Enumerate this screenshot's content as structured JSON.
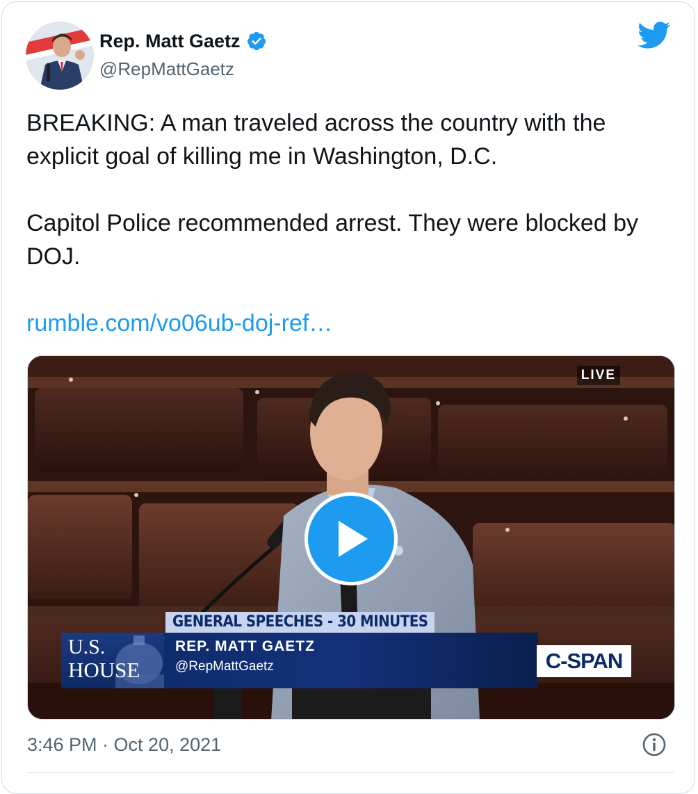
{
  "author": {
    "name": "Rep. Matt Gaetz",
    "handle": "@RepMattGaetz",
    "verified": true,
    "avatar_icon": "avatar-photo"
  },
  "tweet": {
    "paragraphs": [
      "BREAKING: A man traveled across the country with the explicit goal of killing me in Washington, D.C.",
      "Capitol Police recommended arrest. They were blocked by DOJ."
    ],
    "link_text": "rumble.com/vo06ub-doj-ref…"
  },
  "media": {
    "live_badge": "LIVE",
    "lower_third_title": "GENERAL SPEECHES - 30 MINUTES",
    "speaker_name": "REP. MATT GAETZ",
    "speaker_handle": "@RepMattGaetz",
    "house_logo_line1": "U.S.",
    "house_logo_line2": "HOUSE",
    "network_logo": "C-SPAN",
    "play_icon": "play-icon"
  },
  "footer": {
    "timestamp": "3:46 PM · Oct 20, 2021",
    "info_icon": "info-icon"
  },
  "colors": {
    "accent": "#1d9bf0",
    "text": "#0f1419",
    "secondary": "#536471",
    "border": "#cfd9de"
  }
}
